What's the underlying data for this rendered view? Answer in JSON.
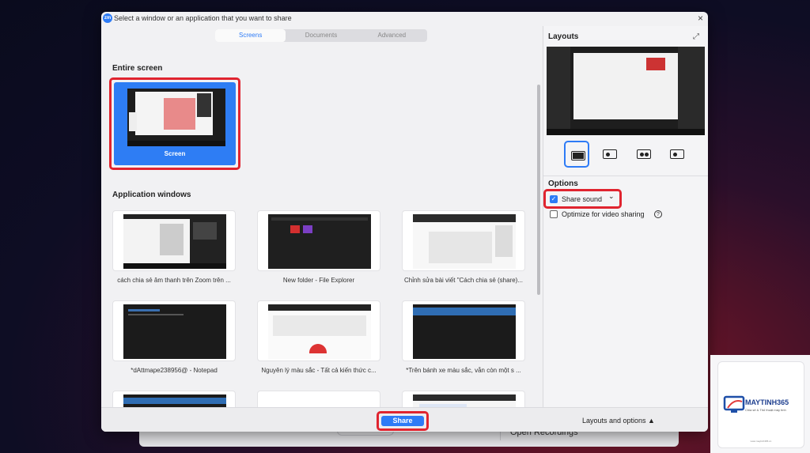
{
  "background": {
    "open_recordings": "Open Recordings"
  },
  "dialog": {
    "logo_text": "zm",
    "title": "Select a window or an application that you want to share",
    "close_symbol": "×"
  },
  "tabs": [
    {
      "label": "Screens",
      "active": true
    },
    {
      "label": "Documents",
      "active": false
    },
    {
      "label": "Advanced",
      "active": false
    }
  ],
  "entire_screen": {
    "title": "Entire screen",
    "screen_label": "Screen"
  },
  "app_windows": {
    "title": "Application windows",
    "items": [
      {
        "label": "cách chia sẻ âm thanh trên Zoom trên ..."
      },
      {
        "label": "New folder - File Explorer"
      },
      {
        "label": "Chỉnh sửa bài viết \"Cách chia sẻ (share)..."
      },
      {
        "label": "*dAttmape238956@ - Notepad"
      },
      {
        "label": "Nguyên lý màu sắc - Tất cả kiến thức c..."
      },
      {
        "label": "*Trên bánh xe màu sắc, vẫn còn một s ..."
      },
      {
        "label": ""
      },
      {
        "label": ""
      },
      {
        "label": ""
      }
    ]
  },
  "right_panel": {
    "layouts_title": "Layouts",
    "expand_icon": "expand-icon",
    "options_title": "Options",
    "share_sound": {
      "label": "Share sound",
      "checked": true,
      "chevron": "⌄"
    },
    "optimize_video": {
      "label": "Optimize for video sharing",
      "checked": false,
      "help": "?"
    }
  },
  "footer": {
    "share_label": "Share",
    "layouts_options_label": "Layouts and options ▲"
  },
  "watermark": {
    "brand": "MAYTINH365",
    "tagline": "Chia sẻ & Thủ thuật máy tính",
    "footer": "www.maytinh365.vn"
  },
  "colors": {
    "accent": "#2d7bf6",
    "highlight": "#e0242f"
  }
}
